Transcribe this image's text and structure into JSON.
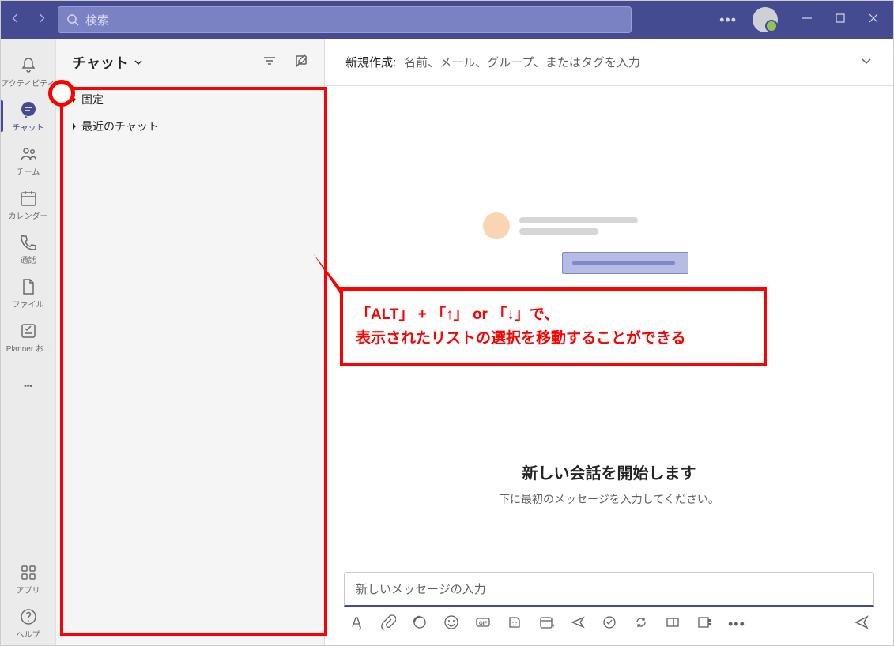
{
  "titlebar": {
    "search_placeholder": "検索"
  },
  "rail": {
    "activity": "アクティビティ",
    "chat": "チャット",
    "teams": "チーム",
    "calendar": "カレンダー",
    "calls": "通話",
    "files": "ファイル",
    "planner": "Planner お...",
    "apps": "アプリ",
    "help": "ヘルプ"
  },
  "chatpanel": {
    "title": "チャット",
    "pinned": "固定",
    "recent": "最近のチャット"
  },
  "newchat": {
    "label": "新規作成:",
    "placeholder": "名前、メール、グループ、またはタグを入力"
  },
  "conversation": {
    "title": "新しい会話を開始します",
    "subtitle": "下に最初のメッセージを入力してください。"
  },
  "compose": {
    "placeholder": "新しいメッセージの入力"
  },
  "annotation": {
    "line1": "「ALT」 + 「↑」 or 「↓」で、",
    "line2": "表示されたリストの選択を移動することができる"
  }
}
